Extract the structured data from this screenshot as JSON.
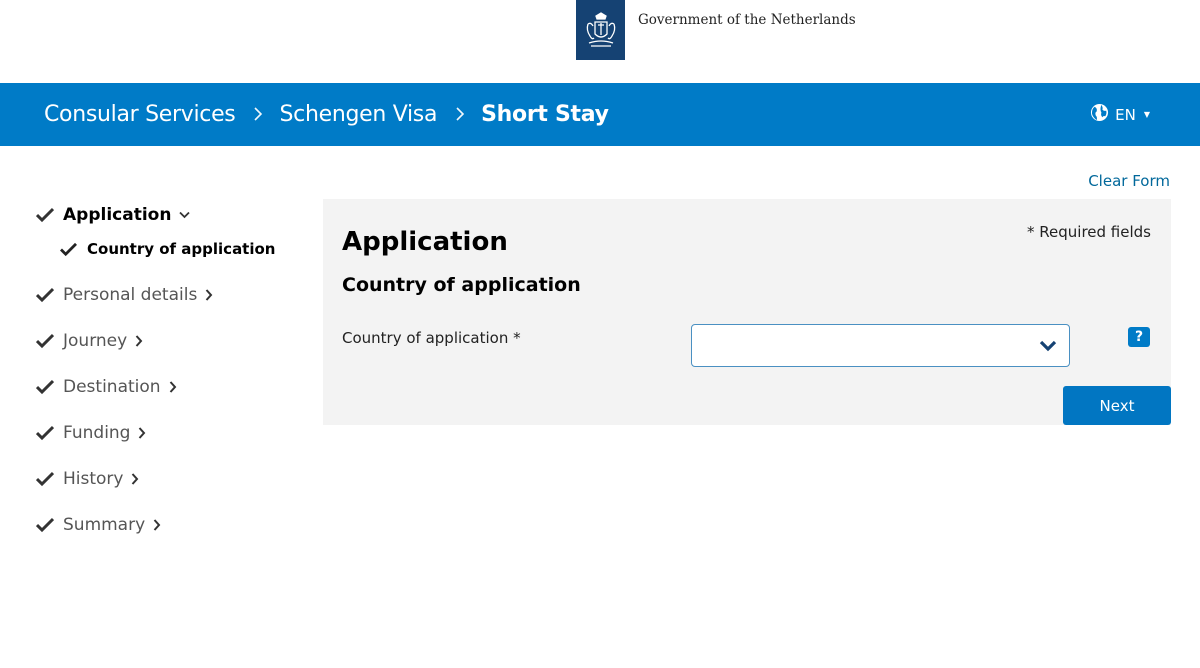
{
  "header": {
    "gov_name": "Government of the Netherlands",
    "logo_icon": "coat-of-arms-icon"
  },
  "topbar": {
    "breadcrumbs": [
      "Consular Services",
      "Schengen Visa",
      "Short Stay"
    ],
    "language": "EN",
    "bg_color": "#007bc7"
  },
  "clear_form_label": "Clear Form",
  "sidebar": {
    "steps": [
      {
        "label": "Application",
        "active": true
      },
      {
        "label": "Personal details"
      },
      {
        "label": "Journey"
      },
      {
        "label": "Destination"
      },
      {
        "label": "Funding"
      },
      {
        "label": "History"
      },
      {
        "label": "Summary"
      }
    ],
    "substep": "Country of application"
  },
  "form": {
    "title": "Application",
    "subtitle": "Country of application",
    "required_note": "* Required fields",
    "field_label": "Country of application *",
    "select_value": "",
    "help_label": "?",
    "next_label": "Next"
  }
}
